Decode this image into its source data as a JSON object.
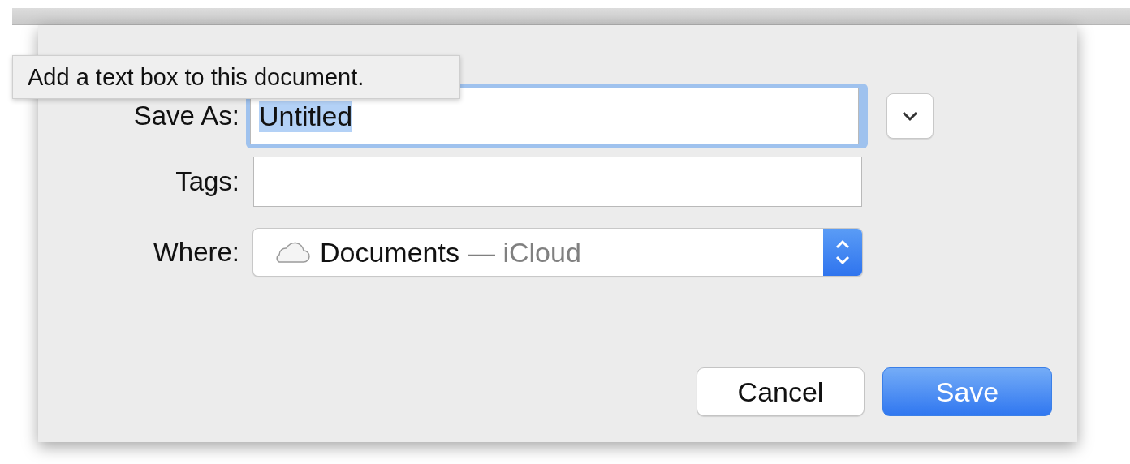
{
  "tooltip": {
    "text": "Add a text box to this document."
  },
  "save_as": {
    "label": "Save As:",
    "value": "Untitled",
    "focused": true,
    "text_selected": true
  },
  "tags": {
    "label": "Tags:"
  },
  "where": {
    "label": "Where:",
    "folder": "Documents",
    "location": "— iCloud"
  },
  "buttons": [
    {
      "label": "Cancel",
      "default": false
    },
    {
      "label": "Save",
      "default": true
    }
  ]
}
